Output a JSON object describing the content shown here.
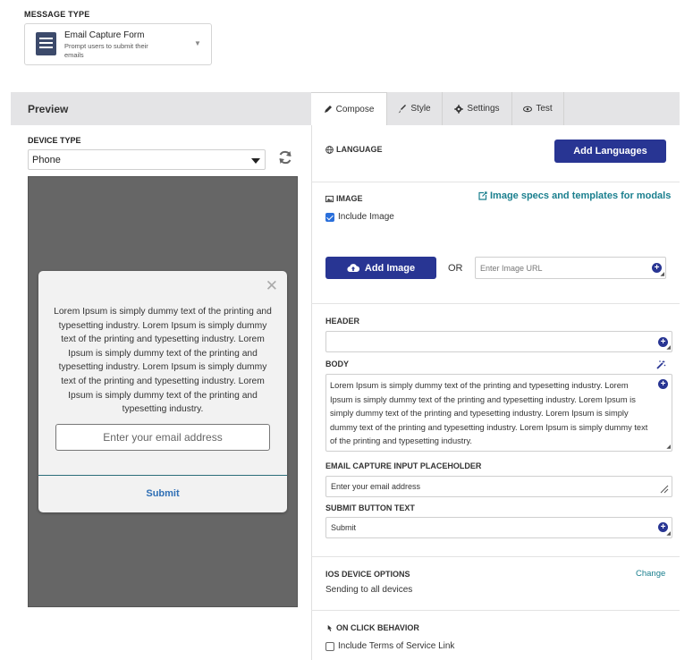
{
  "message_type": {
    "label": "MESSAGE TYPE",
    "selected_title": "Email Capture Form",
    "selected_desc": "Prompt users to submit their emails",
    "caret": "▼"
  },
  "preview": {
    "title": "Preview",
    "device_type_label": "DEVICE TYPE",
    "device_value": "Phone",
    "modal": {
      "close": "✕",
      "body": "Lorem Ipsum is simply dummy text of the printing and typesetting industry. Lorem Ipsum is simply dummy text of the printing and typesetting industry. Lorem Ipsum is simply dummy text of the printing and typesetting industry. Lorem Ipsum is simply dummy text of the printing and typesetting industry. Lorem Ipsum is simply dummy text of the printing and typesetting industry.",
      "input_placeholder": "Enter your email address",
      "submit": "Submit"
    }
  },
  "tabs": [
    {
      "label": "Compose",
      "icon": "pencil-icon",
      "active": true
    },
    {
      "label": "Style",
      "icon": "brush-icon",
      "active": false
    },
    {
      "label": "Settings",
      "icon": "gear-icon",
      "active": false
    },
    {
      "label": "Test",
      "icon": "eye-icon",
      "active": false
    }
  ],
  "compose": {
    "language_label": "LANGUAGE",
    "add_languages": "Add Languages",
    "image_label": "IMAGE",
    "image_specs_link": "Image specs and templates for modals",
    "include_image": "Include Image",
    "include_image_checked": true,
    "add_image": "Add Image",
    "or": "OR",
    "image_url_placeholder": "Enter Image URL",
    "header_label": "HEADER",
    "header_value": "",
    "body_label": "BODY",
    "body_value": "Lorem Ipsum is simply dummy text of the printing and typesetting industry. Lorem Ipsum is simply dummy text of the printing and typesetting industry. Lorem Ipsum is simply dummy text of the printing and typesetting industry. Lorem Ipsum is simply dummy text of the printing and typesetting industry. Lorem Ipsum is simply dummy text of the printing and typesetting industry.",
    "email_placeholder_label": "EMAIL CAPTURE INPUT PLACEHOLDER",
    "email_placeholder_value": "Enter your email address",
    "submit_text_label": "SUBMIT BUTTON TEXT",
    "submit_text_value": "Submit",
    "ios_label": "IOS DEVICE OPTIONS",
    "ios_change": "Change",
    "ios_value": "Sending to all devices",
    "onclick_label": "ON CLICK BEHAVIOR",
    "terms_label": "Include Terms of Service Link",
    "terms_checked": false
  },
  "colors": {
    "primary": "#283593",
    "link": "#1a7f8e",
    "preview_bg": "#666666"
  }
}
